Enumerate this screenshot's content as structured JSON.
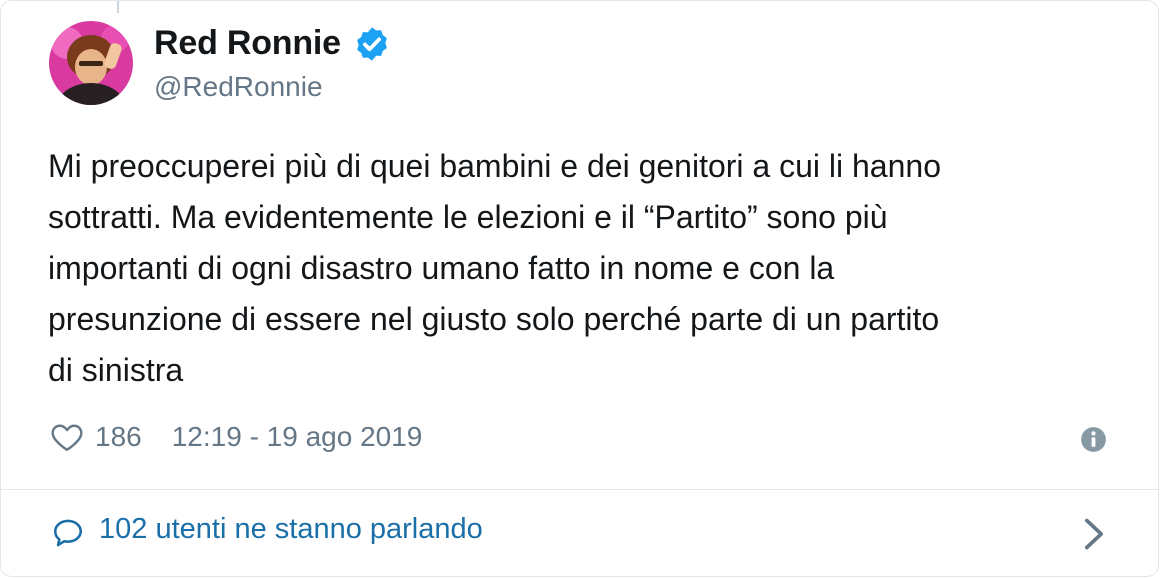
{
  "tweet": {
    "author": {
      "display_name": "Red Ronnie",
      "handle": "@RedRonnie",
      "verified": true
    },
    "text": "Mi preoccuperei più di quei bambini e dei genitori a cui li hanno\nsottratti. Ma evidentemente le elezioni e il “Partito” sono più\nimportanti di ogni disastro umano fatto in nome e con la\npresunzione di essere nel giusto solo perché parte di un partito\ndi sinistra",
    "likes": "186",
    "timestamp": "12:19 - 19 ago 2019",
    "footer_text": "102 utenti ne stanno parlando"
  },
  "icons": {
    "verified": "verified-badge-icon",
    "like": "heart-outline-icon",
    "info": "info-circle-icon",
    "reply": "speech-bubble-icon",
    "chevron": "chevron-right-icon"
  },
  "colors": {
    "text": "#14171a",
    "secondary": "#657786",
    "link": "#1b6fa8",
    "verified": "#1da1f2",
    "border": "#e1e8ed"
  }
}
